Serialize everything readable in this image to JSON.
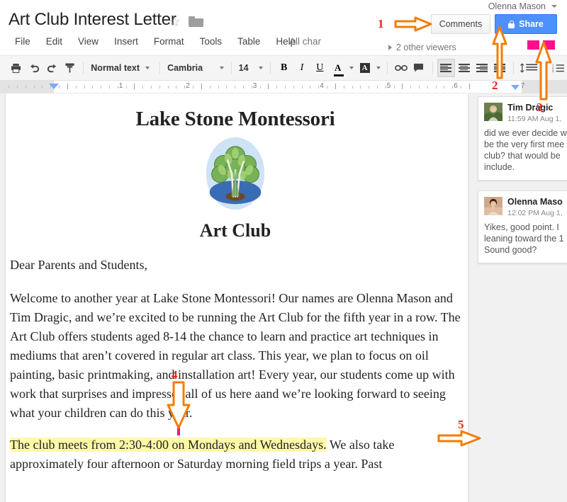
{
  "app": {
    "title": "Art Club Interest Letter",
    "user": "Olenna Mason",
    "save_status": "All char",
    "star_icon": "star-outline-icon",
    "folder_icon": "folder-icon"
  },
  "menubar": {
    "items": [
      {
        "label": "File"
      },
      {
        "label": "Edit"
      },
      {
        "label": "View"
      },
      {
        "label": "Insert"
      },
      {
        "label": "Format"
      },
      {
        "label": "Tools"
      },
      {
        "label": "Table"
      },
      {
        "label": "Help"
      }
    ]
  },
  "header_actions": {
    "comments_label": "Comments",
    "share_label": "Share",
    "share_icon": "lock-icon",
    "viewers_label": "2 other viewers",
    "share_bg": "#4d90fe"
  },
  "toolbar": {
    "print_icon": "print-icon",
    "undo_icon": "undo-icon",
    "redo_icon": "redo-icon",
    "paint_format_icon": "paint-format-icon",
    "style_value": "Normal text",
    "font_value": "Cambria",
    "size_value": "14",
    "bold_label": "B",
    "italic_label": "I",
    "underline_label": "U",
    "text_color_label": "A",
    "highlight_label": "A",
    "link_icon": "link-icon",
    "comment_icon": "add-comment-icon",
    "align_left_icon": "align-left-icon",
    "align_center_icon": "align-center-icon",
    "align_right_icon": "align-right-icon",
    "align_justify_icon": "align-justify-icon",
    "line_spacing_icon": "line-spacing-icon",
    "numbered_list_icon": "numbered-list-icon"
  },
  "ruler": {
    "numbers": [
      "1",
      "2",
      "3",
      "4",
      "5",
      "6",
      "7"
    ]
  },
  "document": {
    "heading": "Lake Stone Montessori",
    "logo_icon": "tree-logo-image",
    "subheading": "Art Club",
    "salutation": "Dear Parents and Students,",
    "paragraph1": "Welcome to another year at Lake Stone Montessori! Our names are Olenna Mason and Tim Dragic, and we’re excited to be running the Art Club for the fifth year in a row. The Art Club offers students aged 8-14 the chance to learn and practice art techniques in mediums that aren’t covered in regular art class. This year, we plan to focus on oil painting, basic printmaking, and installation art! Every year, our students come up with work that surprises and impresses all of us here a",
    "paragraph1_cont": "and we’re looking forward to seeing what your children can do this year.",
    "paragraph2_highlight": "The club meets from 2:30-4:00 on Mondays and Wednesdays.",
    "paragraph2_rest": " We also take approximately four afternoon or Saturday morning field trips a year. Past",
    "highlight_color": "#fdf9a8"
  },
  "comments": [
    {
      "author": "Tim Dragic",
      "time": "11:59 AM Aug 1,",
      "avatar": "tim-dragic-avatar",
      "lines": [
        "did we ever decide w",
        "be the very first mee",
        "club? that would be",
        "include."
      ]
    },
    {
      "author": "Olenna Maso",
      "time": "12:02 PM Aug 1,",
      "avatar": "olenna-mason-avatar",
      "lines": [
        "Yikes, good point. I",
        "leaning toward the 1",
        "Sound good?"
      ]
    }
  ],
  "annotations": {
    "color": "#f57c00",
    "number_color": "#e8231a",
    "marker_color": "#ff0f8c",
    "items": [
      {
        "id": "1",
        "target": "comments-button"
      },
      {
        "id": "2",
        "target": "align-justify-button"
      },
      {
        "id": "3",
        "target": "line-spacing-button"
      },
      {
        "id": "4",
        "target": "text-cursor-in-paragraph"
      },
      {
        "id": "5",
        "target": "olenna-mason-comment-avatar"
      }
    ]
  }
}
